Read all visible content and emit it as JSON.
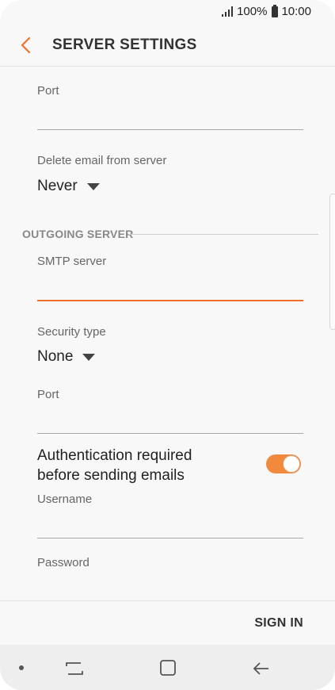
{
  "status": {
    "battery": "100%",
    "time": "10:00"
  },
  "header": {
    "title": "SERVER SETTINGS"
  },
  "incoming": {
    "port_label": "Port",
    "port_value": "",
    "delete_label": "Delete email from server",
    "delete_value": "Never"
  },
  "outgoing": {
    "section_title": "OUTGOING SERVER",
    "smtp_label": "SMTP server",
    "smtp_value": "",
    "security_label": "Security type",
    "security_value": "None",
    "port_label": "Port",
    "port_value": "",
    "auth_label": "Authentication required before sending emails",
    "auth_enabled": true,
    "username_label": "Username",
    "username_value": "",
    "password_label": "Password"
  },
  "footer": {
    "sign_in_label": "SIGN IN"
  },
  "colors": {
    "accent": "#f0712c",
    "toggle_on": "#f28a3e"
  },
  "icons": {
    "back": "chevron-left-icon",
    "dropdown": "caret-down-icon",
    "recent": "recent-apps-icon",
    "home": "home-icon",
    "nav_back": "back-arrow-icon"
  }
}
